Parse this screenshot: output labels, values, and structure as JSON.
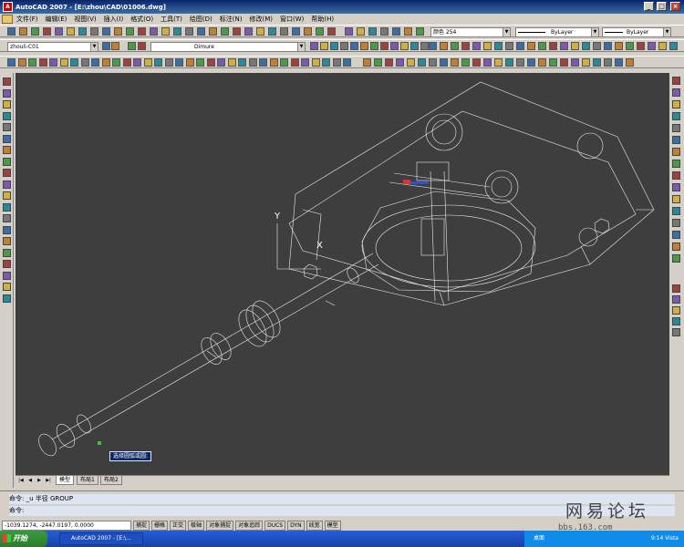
{
  "window": {
    "title": "AutoCAD 2007 - [E:\\zhou\\CAD\\01006.dwg]",
    "app_icon": "A"
  },
  "menu": [
    "文件(F)",
    "编辑(E)",
    "视图(V)",
    "插入(I)",
    "格式(O)",
    "工具(T)",
    "绘图(D)",
    "标注(N)",
    "修改(M)",
    "窗口(W)",
    "帮助(H)"
  ],
  "toolbar": {
    "layer_name": "zhouli-C01",
    "text_style": "Dimure",
    "color_select": "颜色 254",
    "linetype_select": "ByLayer",
    "lineweight_select": "ByLayer"
  },
  "canvas": {
    "tooltip": "选择圆弧或圆:",
    "ucs_y_label": "Y",
    "ucs_x_label": "X"
  },
  "layout_tabs": [
    "模型",
    "布局1",
    "布局2"
  ],
  "command": {
    "line1": "命令: _u 半径 GROUP",
    "line2": "命令:"
  },
  "status": {
    "coords": "-1039.1274, -2447.0197, 0.0000",
    "buttons": [
      "捕捉",
      "栅格",
      "正交",
      "极轴",
      "对象捕捉",
      "对象追踪",
      "DUCS",
      "DYN",
      "线宽",
      "模型"
    ]
  },
  "taskbar": {
    "start_label": "开始",
    "task_label": "AutoCAD 2007 - [E:\\...",
    "tray_label": "桌面",
    "clock": "9:14 Vista"
  },
  "watermark": {
    "main": "网易论坛",
    "sub": "bbs.163.com"
  },
  "colors": {
    "canvas_bg": "#3e3e3e",
    "wireframe": "#ffffff",
    "title_bar": "#0a246a",
    "taskbar": "#245edb"
  }
}
